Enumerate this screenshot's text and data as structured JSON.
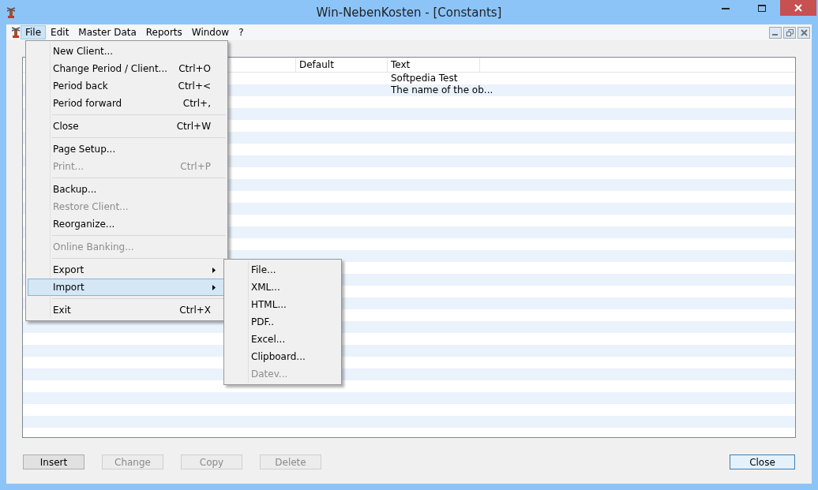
{
  "window": {
    "title": "Win-NebenKosten - [Constants]"
  },
  "menubar": [
    {
      "label": "File",
      "selected": true
    },
    {
      "label": "Edit",
      "selected": false
    },
    {
      "label": "Master Data",
      "selected": false
    },
    {
      "label": "Reports",
      "selected": false
    },
    {
      "label": "Window",
      "selected": false
    },
    {
      "label": "?",
      "selected": false
    }
  ],
  "file_menu": [
    {
      "kind": "item",
      "label": "New Client...",
      "disabled": false,
      "selected": false
    },
    {
      "kind": "item",
      "label": "Change Period / Client...",
      "shortcut": "Ctrl+O",
      "disabled": false,
      "selected": false
    },
    {
      "kind": "item",
      "label": "Period back",
      "shortcut": "Ctrl+<",
      "disabled": false,
      "selected": false
    },
    {
      "kind": "item",
      "label": "Period forward",
      "shortcut": "Ctrl+,",
      "disabled": false,
      "selected": false
    },
    {
      "kind": "separator"
    },
    {
      "kind": "item",
      "label": "Close",
      "shortcut": "Ctrl+W",
      "disabled": false,
      "selected": false
    },
    {
      "kind": "separator"
    },
    {
      "kind": "item",
      "label": "Page Setup...",
      "disabled": false,
      "selected": false
    },
    {
      "kind": "item",
      "label": "Print...",
      "shortcut": "Ctrl+P",
      "disabled": true,
      "selected": false
    },
    {
      "kind": "separator"
    },
    {
      "kind": "item",
      "label": "Backup...",
      "disabled": false,
      "selected": false
    },
    {
      "kind": "item",
      "label": "Restore Client...",
      "disabled": true,
      "selected": false
    },
    {
      "kind": "item",
      "label": "Reorganize...",
      "disabled": false,
      "selected": false
    },
    {
      "kind": "separator"
    },
    {
      "kind": "item",
      "label": "Online Banking...",
      "disabled": true,
      "selected": false
    },
    {
      "kind": "separator"
    },
    {
      "kind": "submenu",
      "label": "Export",
      "disabled": false,
      "selected": false
    },
    {
      "kind": "submenu",
      "label": "Import",
      "disabled": false,
      "selected": true
    },
    {
      "kind": "separator"
    },
    {
      "kind": "item",
      "label": "Exit",
      "shortcut": "Ctrl+X",
      "disabled": false,
      "selected": false
    }
  ],
  "import_submenu": [
    {
      "label": "File...",
      "disabled": false
    },
    {
      "label": "XML...",
      "disabled": false
    },
    {
      "label": "HTML...",
      "disabled": false
    },
    {
      "label": "PDF..",
      "disabled": false
    },
    {
      "label": "Excel...",
      "disabled": false
    },
    {
      "label": "Clipboard...",
      "disabled": false
    },
    {
      "label": "Datev...",
      "disabled": true
    }
  ],
  "table": {
    "columns": [
      "Default",
      "Text"
    ],
    "rows": [
      {
        "default": "",
        "text": "Softpedia Test"
      },
      {
        "default": "",
        "text": "The name of the ob..."
      }
    ]
  },
  "buttons": [
    {
      "label": "Insert",
      "disabled": false,
      "default": false
    },
    {
      "label": "Change",
      "disabled": true,
      "default": false
    },
    {
      "label": "Copy",
      "disabled": true,
      "default": false
    },
    {
      "label": "Delete",
      "disabled": true,
      "default": false
    },
    {
      "label": "Close",
      "disabled": false,
      "default": true
    }
  ]
}
